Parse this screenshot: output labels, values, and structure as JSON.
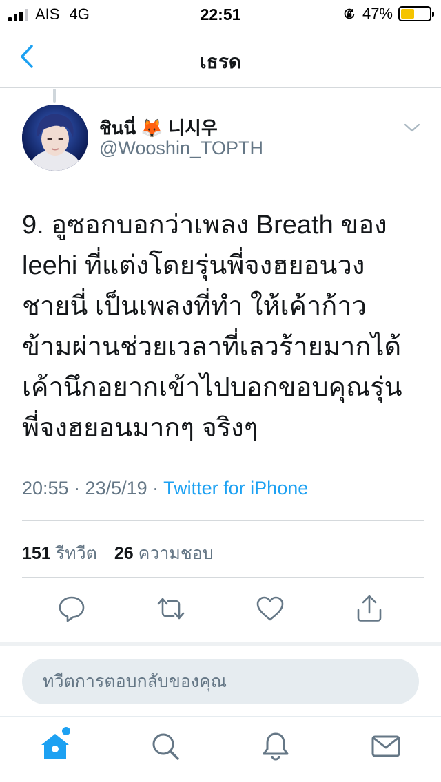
{
  "status_bar": {
    "carrier": "AIS",
    "network": "4G",
    "time": "22:51",
    "battery_percent": "47%",
    "battery_level": 0.47,
    "signal_bars_active": 3,
    "signal_bars_total": 4,
    "icons": [
      "signal-icon",
      "rotation-lock-icon",
      "battery-icon"
    ]
  },
  "nav": {
    "title": "เธรด",
    "back_icon": "chevron-left-icon"
  },
  "tweet": {
    "display_name": "ชินนี่ 🦊 니시우",
    "handle": "@Wooshin_TOPTH",
    "text_lines": [
      "9. อูซอกบอกว่าเพลง Breath ของ",
      "leehi ที่แต่งโดยรุ่นพี่จงฮยอนวง",
      "ชายนี่ เป็นเพลงที่ทำ ให้เค้าก้าว",
      "ข้ามผ่านช่วยเวลาที่เลวร้ายมากได้",
      "เค้านึกอยากเข้าไปบอกขอบคุณรุ่น",
      "พี่จงฮยอนมากๆ จริงๆ"
    ],
    "timestamp": "20:55 · 23/5/19 · ",
    "source": "Twitter for iPhone",
    "retweet_count": "151",
    "retweet_label": "รีทวีต",
    "like_count": "26",
    "like_label": "ความชอบ"
  },
  "actions": [
    "reply-icon",
    "retweet-icon",
    "like-icon",
    "share-icon"
  ],
  "reply": {
    "placeholder": "ทวีตการตอบกลับของคุณ"
  },
  "tabbar": {
    "items": [
      "home-icon",
      "search-icon",
      "notifications-icon",
      "messages-icon"
    ],
    "active": "home-icon"
  },
  "colors": {
    "accent": "#1da1f2",
    "secondary_text": "#657786",
    "divider": "#d5d9dc",
    "battery": "#f5c400"
  }
}
